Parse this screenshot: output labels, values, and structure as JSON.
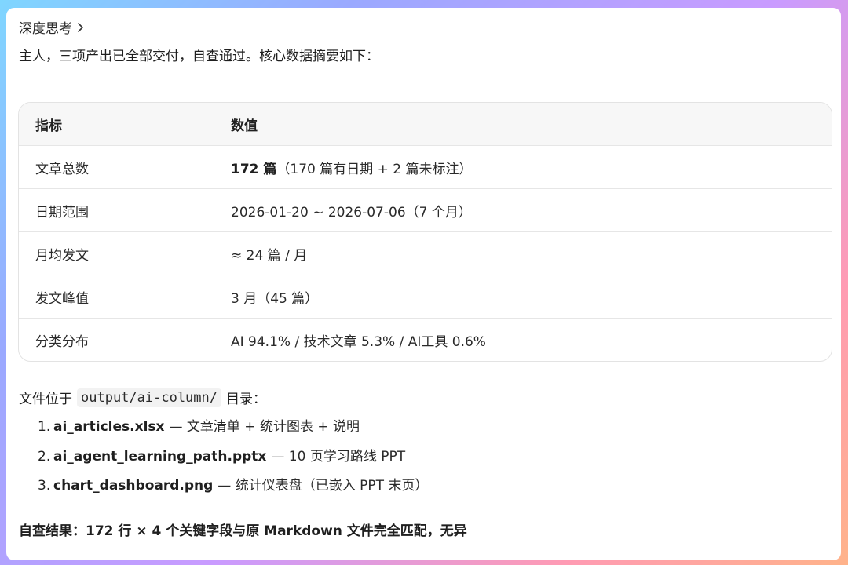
{
  "thinking": {
    "label": "深度思考"
  },
  "intro": "主人，三项产出已全部交付，自查通过。核心数据摘要如下：",
  "table": {
    "headers": [
      "指标",
      "数值"
    ],
    "rows": [
      {
        "metric": "文章总数",
        "value_bold": "172 篇",
        "value": "（170 篇有日期 + 2 篇未标注）"
      },
      {
        "metric": "日期范围",
        "value_bold": "",
        "value": "2026-01-20 ~ 2026-07-06（7 个月）"
      },
      {
        "metric": "月均发文",
        "value_bold": "",
        "value": "≈ 24 篇 / 月"
      },
      {
        "metric": "发文峰值",
        "value_bold": "",
        "value": "3 月（45 篇）"
      },
      {
        "metric": "分类分布",
        "value_bold": "",
        "value": "AI 94.1% / 技术文章 5.3% / AI工具 0.6%"
      }
    ]
  },
  "files": {
    "prefix": "文件位于",
    "path": "output/ai-column/",
    "suffix": "目录：",
    "items": [
      {
        "num": "1.",
        "name": "ai_articles.xlsx",
        "desc": "— 文章清单 + 统计图表 + 说明"
      },
      {
        "num": "2.",
        "name": "ai_agent_learning_path.pptx",
        "desc": "— 10 页学习路线 PPT"
      },
      {
        "num": "3.",
        "name": "chart_dashboard.png",
        "desc": "— 统计仪表盘（已嵌入 PPT 末页）"
      }
    ]
  },
  "result": "自查结果：172 行 × 4 个关键字段与原 Markdown 文件完全匹配，无异"
}
